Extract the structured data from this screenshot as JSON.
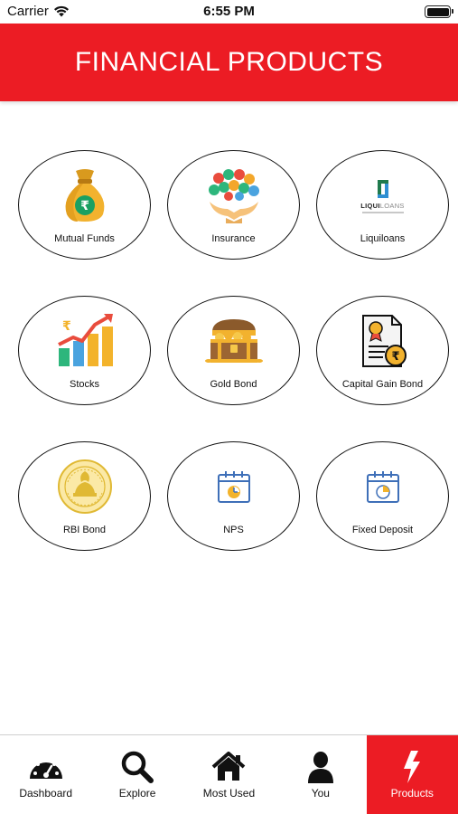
{
  "status_bar": {
    "carrier": "Carrier",
    "time": "6:55 PM"
  },
  "header": {
    "title": "FINANCIAL PRODUCTS",
    "color": "#ec1c24"
  },
  "products": [
    {
      "label": "Mutual Funds",
      "icon": "money-bag-rupee-icon"
    },
    {
      "label": "Insurance",
      "icon": "insurance-hands-icon"
    },
    {
      "label": "Liquiloans",
      "icon": "liquiloans-logo"
    },
    {
      "label": "Stocks",
      "icon": "stocks-growth-chart-icon"
    },
    {
      "label": "Gold Bond",
      "icon": "treasure-chest-icon"
    },
    {
      "label": "Capital Gain Bond",
      "icon": "certificate-rupee-icon"
    },
    {
      "label": "RBI Bond",
      "icon": "rbi-seal-icon"
    },
    {
      "label": "NPS",
      "icon": "calendar-clock-icon"
    },
    {
      "label": "Fixed Deposit",
      "icon": "calendar-timer-icon"
    }
  ],
  "liquiloans_logo": {
    "brand_dark": "LIQUI",
    "brand_light": "LOANS"
  },
  "tabs": [
    {
      "label": "Dashboard",
      "icon": "dashboard-gauge-icon",
      "active": false
    },
    {
      "label": "Explore",
      "icon": "search-icon",
      "active": false
    },
    {
      "label": "Most Used",
      "icon": "home-icon",
      "active": false
    },
    {
      "label": "You",
      "icon": "user-icon",
      "active": false
    },
    {
      "label": "Products",
      "icon": "lightning-icon",
      "active": true
    }
  ]
}
